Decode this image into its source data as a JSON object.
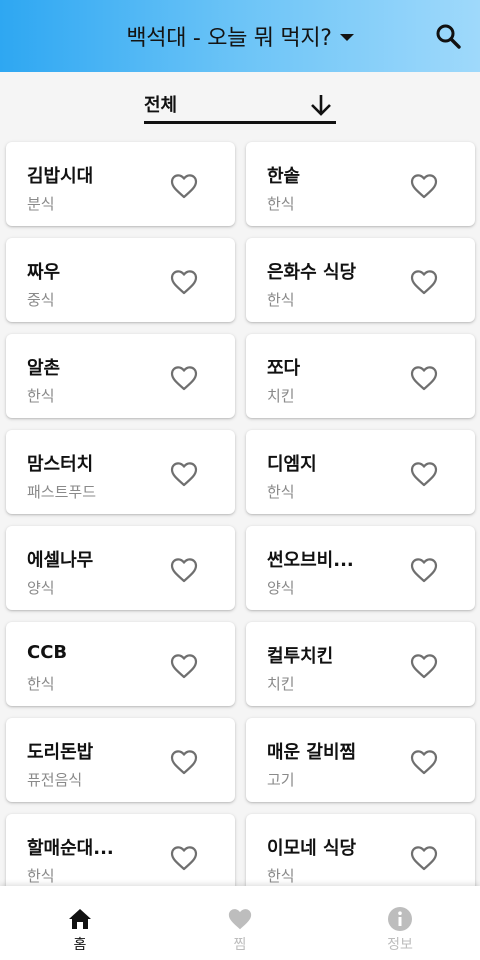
{
  "appbar": {
    "title": "백석대 - 오늘 뭐 먹지?",
    "title_icon": "caret-down-icon",
    "search_icon": "search-icon",
    "gradient": [
      "#2ea7f2",
      "#9fd9fb"
    ]
  },
  "filter": {
    "label": "전체",
    "icon": "arrow-down-icon"
  },
  "restaurants": [
    {
      "name": "김밥시대",
      "category": "분식"
    },
    {
      "name": "한솥",
      "category": "한식"
    },
    {
      "name": "짜우",
      "category": "중식"
    },
    {
      "name": "은화수 식당",
      "category": "한식"
    },
    {
      "name": "알촌",
      "category": "한식"
    },
    {
      "name": "쪼다",
      "category": "치킨"
    },
    {
      "name": "맘스터치",
      "category": "패스트푸드"
    },
    {
      "name": "디엠지",
      "category": "한식"
    },
    {
      "name": "에셀나무",
      "category": "양식"
    },
    {
      "name": "썬오브비...",
      "category": "양식"
    },
    {
      "name": "CCB",
      "category": "한식"
    },
    {
      "name": "컬투치킨",
      "category": "치킨"
    },
    {
      "name": "도리돈밥",
      "category": "퓨전음식"
    },
    {
      "name": "매운 갈비찜",
      "category": "고기"
    },
    {
      "name": "할매순대...",
      "category": "한식"
    },
    {
      "name": "이모네 식당",
      "category": "한식"
    }
  ],
  "bottom_nav": [
    {
      "label": "홈",
      "icon": "home-icon",
      "active": true,
      "color": "#111111"
    },
    {
      "label": "찜",
      "icon": "heart-icon",
      "active": false,
      "color": "#bdbdbd"
    },
    {
      "label": "정보",
      "icon": "info-icon",
      "active": false,
      "color": "#bdbdbd"
    }
  ]
}
